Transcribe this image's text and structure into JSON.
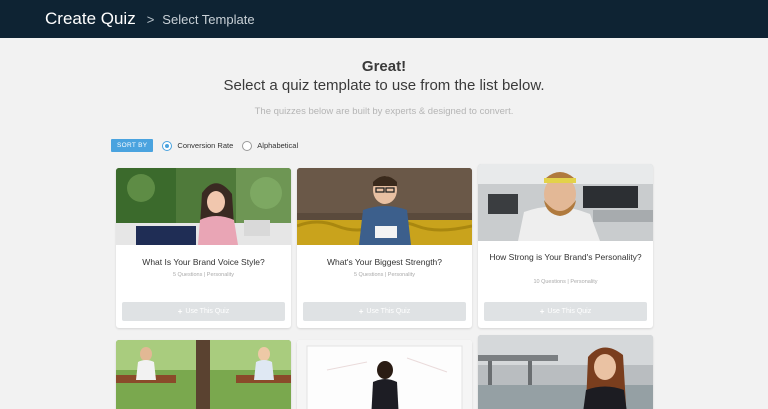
{
  "header": {
    "title": "Create Quiz",
    "separator": ">",
    "breadcrumb": "Select Template"
  },
  "intro": {
    "headline": "Great!",
    "instruction": "Select a quiz template to use from the list below.",
    "subtext": "The quizzes below are built by experts & designed to convert."
  },
  "sort": {
    "badge": "SORT BY",
    "options": [
      {
        "label": "Conversion Rate",
        "selected": true
      },
      {
        "label": "Alphabetical",
        "selected": false
      }
    ]
  },
  "button_label": "Use This Quiz",
  "quizzes": [
    {
      "title": "What Is Your Brand Voice Style?",
      "meta": "5 Questions | Personality"
    },
    {
      "title": "What's Your Biggest Strength?",
      "meta": "5 Questions | Personality"
    },
    {
      "title": "How Strong is Your Brand's Personality?",
      "meta": "10 Questions | Personality"
    }
  ],
  "colors": {
    "header_bg": "#0e2333",
    "accent": "#4aa3df",
    "button_bg": "#dfe2e4"
  }
}
